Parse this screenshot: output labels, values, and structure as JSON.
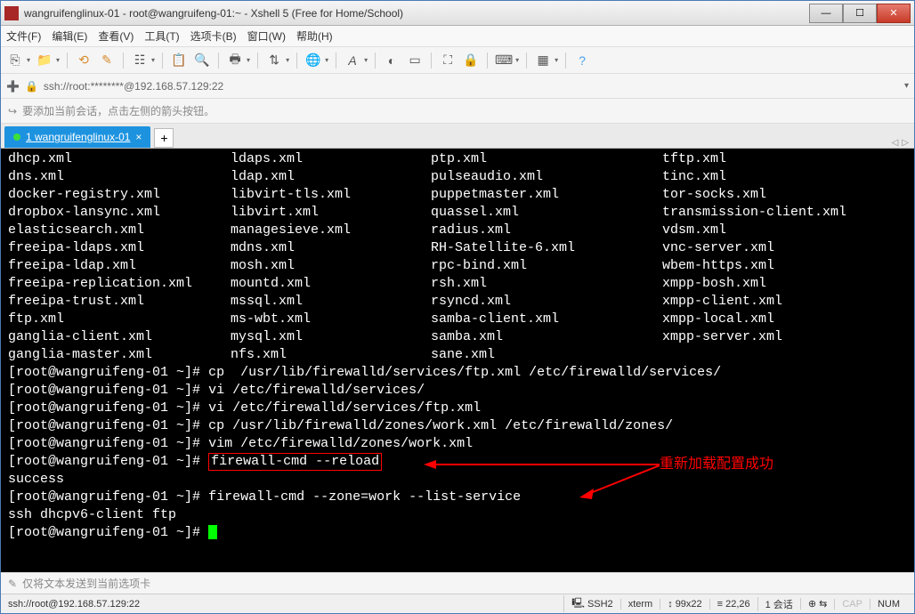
{
  "titlebar": {
    "text": "wangruifenglinux-01 - root@wangruifeng-01:~ - Xshell 5 (Free for Home/School)"
  },
  "menu": {
    "file": "文件(F)",
    "edit": "编辑(E)",
    "view": "查看(V)",
    "tools": "工具(T)",
    "tabs": "选项卡(B)",
    "window": "窗口(W)",
    "help": "帮助(H)"
  },
  "address": {
    "text": "ssh://root:********@192.168.57.129:22"
  },
  "hint": {
    "text": "要添加当前会话，点击左侧的箭头按钮。"
  },
  "tab": {
    "label": "1 wangruifenglinux-01"
  },
  "terminal": {
    "cols": {
      "c1": [
        "dhcp.xml",
        "dns.xml",
        "docker-registry.xml",
        "dropbox-lansync.xml",
        "elasticsearch.xml",
        "freeipa-ldaps.xml",
        "freeipa-ldap.xml",
        "freeipa-replication.xml",
        "freeipa-trust.xml",
        "ftp.xml",
        "ganglia-client.xml",
        "ganglia-master.xml"
      ],
      "c2": [
        "ldaps.xml",
        "ldap.xml",
        "libvirt-tls.xml",
        "libvirt.xml",
        "managesieve.xml",
        "mdns.xml",
        "mosh.xml",
        "mountd.xml",
        "mssql.xml",
        "ms-wbt.xml",
        "mysql.xml",
        "nfs.xml"
      ],
      "c3": [
        "ptp.xml",
        "pulseaudio.xml",
        "puppetmaster.xml",
        "quassel.xml",
        "radius.xml",
        "RH-Satellite-6.xml",
        "rpc-bind.xml",
        "rsh.xml",
        "rsyncd.xml",
        "samba-client.xml",
        "samba.xml",
        "sane.xml"
      ],
      "c4": [
        "tftp.xml",
        "tinc.xml",
        "tor-socks.xml",
        "transmission-client.xml",
        "vdsm.xml",
        "vnc-server.xml",
        "wbem-https.xml",
        "xmpp-bosh.xml",
        "xmpp-client.xml",
        "xmpp-local.xml",
        "xmpp-server.xml",
        ""
      ]
    },
    "prompt": "[root@wangruifeng-01 ~]#",
    "lines": {
      "l1": "cp  /usr/lib/firewalld/services/ftp.xml /etc/firewalld/services/",
      "l2": "vi /etc/firewalld/services/",
      "l3": "vi /etc/firewalld/services/ftp.xml",
      "l4": "cp /usr/lib/firewalld/zones/work.xml /etc/firewalld/zones/",
      "l5": "vim /etc/firewalld/zones/work.xml",
      "l6": "firewall-cmd --reload",
      "l7": "success",
      "l8": "firewall-cmd --zone=work --list-service",
      "l9": "ssh dhcpv6-client ftp"
    },
    "annotation": "重新加载配置成功"
  },
  "bottom_hint": {
    "text": "仅将文本发送到当前选项卡"
  },
  "status": {
    "conn": "ssh://root@192.168.57.129:22",
    "ssh": "SSH2",
    "term": "xterm",
    "size": "99x22",
    "pos": "22,26",
    "sess": "1 会话",
    "cap": "CAP",
    "num": "NUM"
  }
}
